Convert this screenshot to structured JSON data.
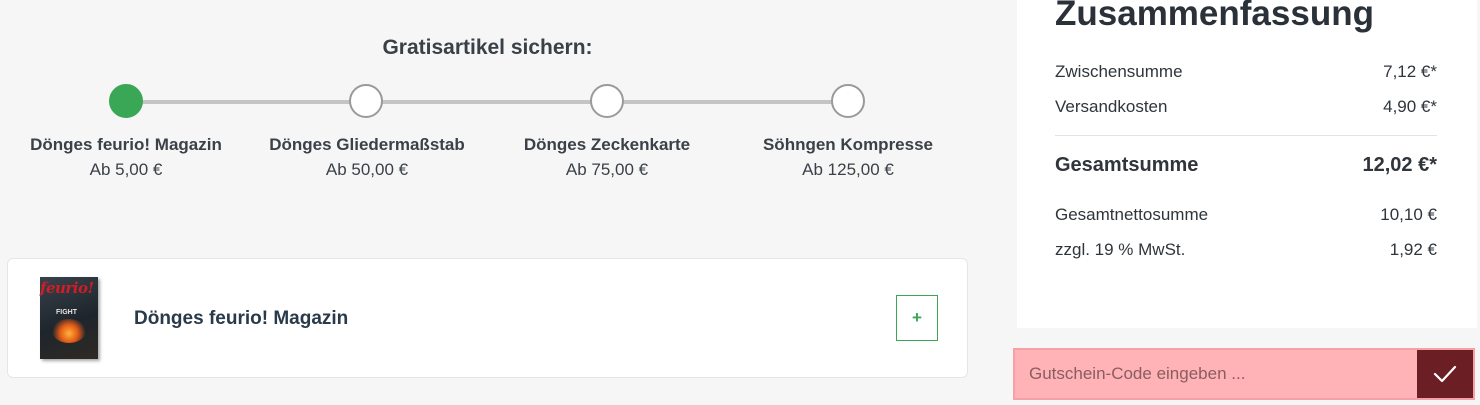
{
  "free_items": {
    "title": "Gratisartikel sichern:",
    "steps": [
      {
        "name": "Dönges feurio! Magazin",
        "price": "Ab 5,00 €",
        "reached": true
      },
      {
        "name": "Dönges Gliedermaßstab",
        "price": "Ab 50,00 €",
        "reached": false
      },
      {
        "name": "Dönges Zeckenkarte",
        "price": "Ab 75,00 €",
        "reached": false
      },
      {
        "name": "Söhngen Kompresse",
        "price": "Ab 125,00 €",
        "reached": false
      }
    ]
  },
  "product_card": {
    "thumbnail_brand": "feurio!",
    "thumbnail_title": "FIGHT",
    "name": "Dönges feurio! Magazin",
    "add_label": "+"
  },
  "summary": {
    "title": "Zusammenfassung",
    "subtotal_label": "Zwischensumme",
    "subtotal_value": "7,12 €*",
    "shipping_label": "Versandkosten",
    "shipping_value": "4,90 €*",
    "total_label": "Gesamtsumme",
    "total_value": "12,02 €*",
    "net_label": "Gesamtnettosumme",
    "net_value": "10,10 €",
    "tax_label": "zzgl. 19 % MwSt.",
    "tax_value": "1,92 €"
  },
  "coupon": {
    "placeholder": "Gutschein-Code eingeben ...",
    "submit_icon": "checkmark-icon"
  },
  "colors": {
    "accent_green": "#3aa757",
    "coupon_highlight": "#ffb3b6",
    "coupon_button": "#6b1e24"
  }
}
